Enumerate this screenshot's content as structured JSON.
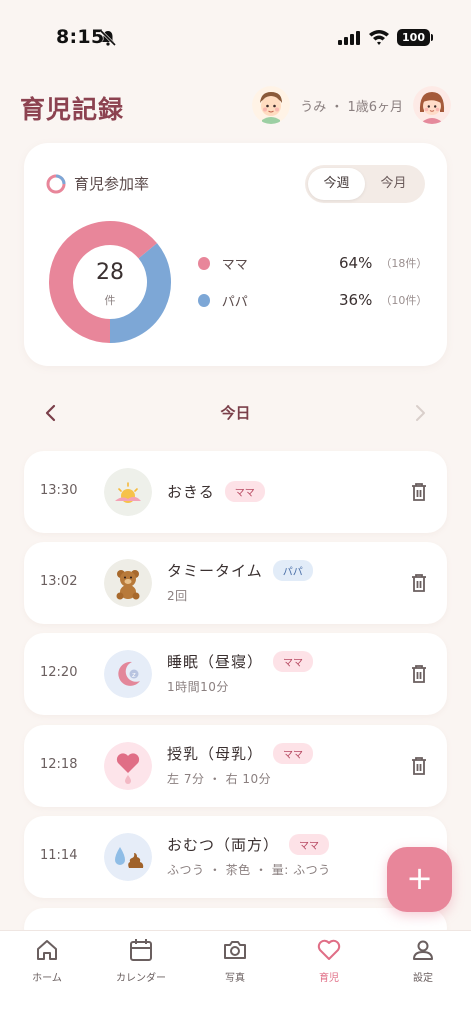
{
  "status": {
    "time": "8:15",
    "battery": "100"
  },
  "header": {
    "title": "育児記録",
    "child_info": "うみ ・ 1歳6ヶ月"
  },
  "summary": {
    "title": "育児参加率",
    "toggle": {
      "week": "今週",
      "month": "今月",
      "selected": "week"
    },
    "total": "28",
    "total_unit": "件",
    "legend": [
      {
        "name": "ママ",
        "percent": "64%",
        "count": "（18件）",
        "color": "#e8869a",
        "value": 64
      },
      {
        "name": "パパ",
        "percent": "36%",
        "count": "（10件）",
        "color": "#7da7d6",
        "value": 36
      }
    ]
  },
  "date_nav": {
    "label": "今日"
  },
  "entries": [
    {
      "time": "13:30",
      "title": "おきる",
      "badge": "ママ",
      "sub": "",
      "icon": "sunrise-icon"
    },
    {
      "time": "13:02",
      "title": "タミータイム",
      "badge": "パパ",
      "sub": "2回",
      "icon": "teddy-bear-icon"
    },
    {
      "time": "12:20",
      "title": "睡眠（昼寝）",
      "badge": "ママ",
      "sub": "1時間10分",
      "icon": "moon-sleep-icon"
    },
    {
      "time": "12:18",
      "title": "授乳（母乳）",
      "badge": "ママ",
      "sub": "左 7分 ・ 右 10分",
      "icon": "heart-drop-icon"
    },
    {
      "time": "11:14",
      "title": "おむつ（両方）",
      "badge": "ママ",
      "sub": "ふつう ・ 茶色 ・ 量: ふつう",
      "icon": "diaper-icon"
    }
  ],
  "fab": {
    "label": "+"
  },
  "tabs": [
    {
      "label": "ホーム",
      "icon": "home-icon"
    },
    {
      "label": "カレンダー",
      "icon": "calendar-icon"
    },
    {
      "label": "写真",
      "icon": "camera-icon"
    },
    {
      "label": "育児",
      "icon": "heart-icon",
      "active": true
    },
    {
      "label": "設定",
      "icon": "person-icon"
    }
  ],
  "colors": {
    "accent": "#e8869a",
    "papa": "#7da7d6",
    "title": "#8c4250"
  }
}
